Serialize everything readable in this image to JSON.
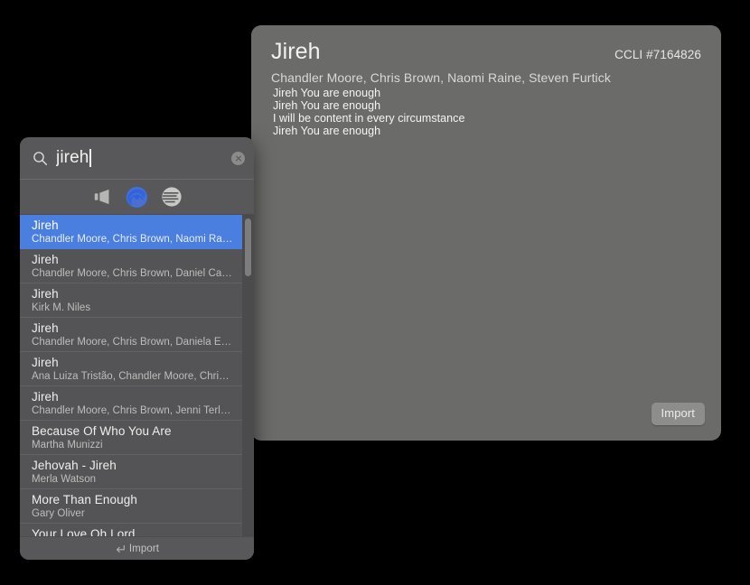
{
  "preview": {
    "title": "Jireh",
    "ccli": "CCLI #7164826",
    "authors": "Chandler Moore, Chris Brown, Naomi Raine, Steven Furtick",
    "lyrics": "Jireh You are enough\nJireh You are enough\nI will be content in every circumstance\nJireh You are enough",
    "import_label": "Import",
    "panel_color": "#6b6b69"
  },
  "search": {
    "query": "jireh",
    "placeholder": "Search",
    "search_icon": "search-icon",
    "clear_icon": "clear-circle-icon",
    "sources": [
      {
        "name": "megaphone-source-icon",
        "label": "Banner",
        "active": false,
        "color": "#b6b6b4"
      },
      {
        "name": "swirl-source-icon",
        "label": "SongSelect",
        "active": true,
        "color": "#3a72e8"
      },
      {
        "name": "lines-circle-source-icon",
        "label": "Library",
        "active": false,
        "color": "#c8c8c6"
      }
    ],
    "results": [
      {
        "title": "Jireh",
        "authors": "Chandler Moore, Chris Brown, Naomi Ra…",
        "selected": true
      },
      {
        "title": "Jireh",
        "authors": "Chandler Moore, Chris Brown, Daniel Ca…",
        "selected": false
      },
      {
        "title": "Jireh",
        "authors": "Kirk M. Niles",
        "selected": false
      },
      {
        "title": "Jireh",
        "authors": "Chandler Moore, Chris Brown, Daniela E…",
        "selected": false
      },
      {
        "title": "Jireh",
        "authors": "Ana Luiza Tristão, Chandler Moore, Chri…",
        "selected": false
      },
      {
        "title": "Jireh",
        "authors": "Chandler Moore, Chris Brown, Jenni Terl…",
        "selected": false
      },
      {
        "title": "Because Of Who You Are",
        "authors": "Martha Munizzi",
        "selected": false
      },
      {
        "title": "Jehovah - Jireh",
        "authors": "Merla Watson",
        "selected": false
      },
      {
        "title": "More Than Enough",
        "authors": "Gary Oliver",
        "selected": false
      },
      {
        "title": "Your Love Oh Lord",
        "authors": "",
        "selected": false
      }
    ],
    "footer": {
      "return_icon": "return-arrow-icon",
      "import_label": "Import"
    },
    "selection_color": "#4a7fe0"
  }
}
